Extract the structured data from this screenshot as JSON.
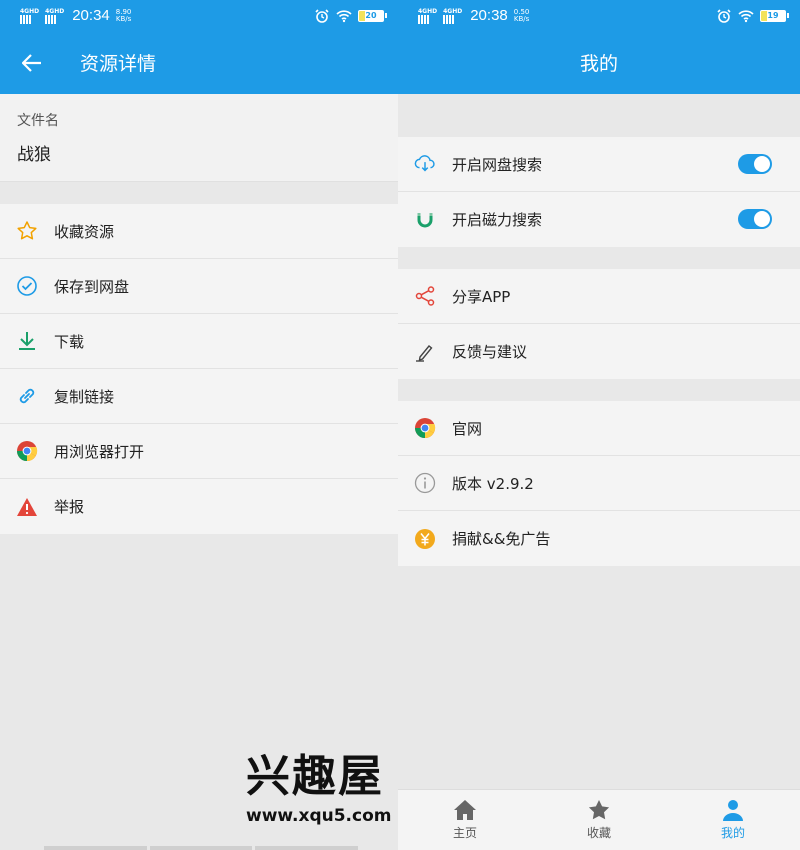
{
  "left": {
    "status": {
      "net1": "4GHD",
      "net2": "4GHD",
      "time": "20:34",
      "speed_value": "8.90",
      "speed_unit": "KB/s",
      "battery": "20"
    },
    "appbar": {
      "title": "资源详情"
    },
    "file": {
      "label": "文件名",
      "value": "战狼"
    },
    "actions": [
      {
        "label": "收藏资源",
        "icon": "star-icon"
      },
      {
        "label": "保存到网盘",
        "icon": "check-circle-icon"
      },
      {
        "label": "下载",
        "icon": "download-icon"
      },
      {
        "label": "复制链接",
        "icon": "link-icon"
      },
      {
        "label": "用浏览器打开",
        "icon": "chrome-icon"
      },
      {
        "label": "举报",
        "icon": "warning-icon"
      }
    ]
  },
  "right": {
    "status": {
      "net1": "4GHD",
      "net2": "4GHD",
      "time": "20:38",
      "speed_value": "0.50",
      "speed_unit": "KB/s",
      "battery": "19"
    },
    "appbar": {
      "title": "我的"
    },
    "settings": [
      {
        "label": "开启网盘搜索",
        "icon": "cloud-download-icon",
        "on": true
      },
      {
        "label": "开启磁力搜索",
        "icon": "magnet-icon",
        "on": true
      }
    ],
    "share": [
      {
        "label": "分享APP",
        "icon": "share-icon"
      },
      {
        "label": "反馈与建议",
        "icon": "pen-icon"
      }
    ],
    "about": [
      {
        "label": "官网",
        "icon": "chrome-icon"
      },
      {
        "label": "版本 v2.9.2",
        "icon": "info-icon"
      },
      {
        "label": "捐献&&免广告",
        "icon": "yen-icon"
      }
    ],
    "nav": [
      {
        "label": "主页",
        "icon": "home-icon",
        "active": false
      },
      {
        "label": "收藏",
        "icon": "star-icon",
        "active": false
      },
      {
        "label": "我的",
        "icon": "person-icon",
        "active": true
      }
    ]
  },
  "watermark": {
    "title": "兴趣屋",
    "url": "www.xqu5.com"
  },
  "colors": {
    "primary": "#1e9be6",
    "background": "#e8e8e8",
    "row": "#f4f4f4"
  }
}
